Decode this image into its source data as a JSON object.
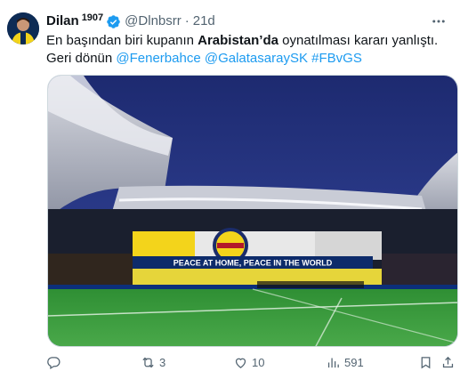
{
  "tweet": {
    "author_name": "Dilan",
    "author_name_suffix": "1907",
    "handle": "@Dlnbsrr",
    "separator": "·",
    "time": "21d",
    "text_part1": "En başından biri kupanın ",
    "text_bold": "Arabistan’da",
    "text_part2": " oynatılması kararı yanlıştı. Geri dönün ",
    "mentions": [
      "@Fenerbahce",
      "@GalatasaraySK"
    ],
    "hashtag": "#FBvGS",
    "image_banner_text": "PEACE AT HOME, PEACE IN THE WORLD",
    "counts": {
      "replies": "",
      "reposts": "3",
      "likes": "10",
      "views": "591"
    }
  },
  "colors": {
    "accent": "#1d9bf0",
    "text": "#0f1419",
    "secondary": "#536471"
  },
  "icons": [
    "verified-badge-icon",
    "more-icon",
    "reply-icon",
    "repost-icon",
    "like-icon",
    "views-icon",
    "bookmark-icon",
    "share-icon"
  ]
}
